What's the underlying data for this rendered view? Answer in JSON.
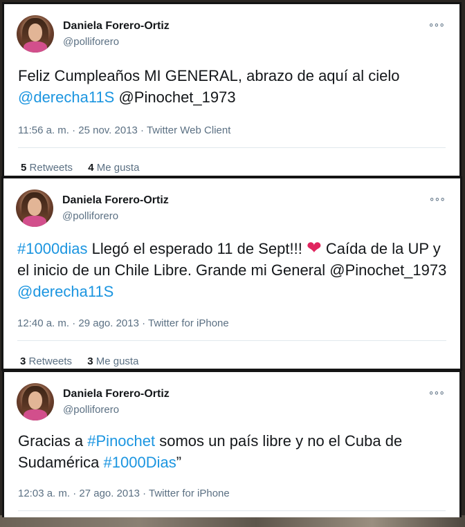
{
  "tweets": [
    {
      "name": "Daniela Forero-Ortiz",
      "handle": "@polliforero",
      "more": "∘∘∘",
      "text": [
        {
          "t": "Feliz Cumpleaños MI GENERAL, abrazo de aquí al cielo",
          "link": false
        },
        {
          "t": "\n",
          "link": false
        },
        {
          "t": "@derecha11S",
          "link": true
        },
        {
          "t": " @Pinochet_1973",
          "link": false
        }
      ],
      "timestamp": "11:56 a. m. · 25 nov. 2013 · Twitter Web Client",
      "retweets_count": "5",
      "retweets_label": "Retweets",
      "likes_count": "4",
      "likes_label": "Me gusta"
    },
    {
      "name": "Daniela Forero-Ortiz",
      "handle": "@polliforero",
      "more": "∘∘∘",
      "text": [
        {
          "t": "#1000dias",
          "link": true
        },
        {
          "t": "  Llegó el esperado 11 de Sept!!! ",
          "link": false
        },
        {
          "t": "❤",
          "heart": true
        },
        {
          "t": " Caída de la UP y el inicio de un Chile Libre. Grande mi General @Pinochet_1973 ",
          "link": false
        },
        {
          "t": "@derecha11S",
          "link": true
        }
      ],
      "timestamp": "12:40 a. m. · 29 ago. 2013 · Twitter for iPhone",
      "retweets_count": "3",
      "retweets_label": "Retweets",
      "likes_count": "3",
      "likes_label": "Me gusta"
    },
    {
      "name": "Daniela Forero-Ortiz",
      "handle": "@polliforero",
      "more": "∘∘∘",
      "text": [
        {
          "t": "Gracias a ",
          "link": false
        },
        {
          "t": "#Pinochet",
          "link": true
        },
        {
          "t": " somos un país libre y no el Cuba de Sudamérica  ",
          "link": false
        },
        {
          "t": "#1000Dias",
          "link": true
        },
        {
          "t": "”",
          "link": false
        }
      ],
      "timestamp": "12:03 a. m. · 27 ago. 2013 · Twitter for iPhone"
    }
  ]
}
